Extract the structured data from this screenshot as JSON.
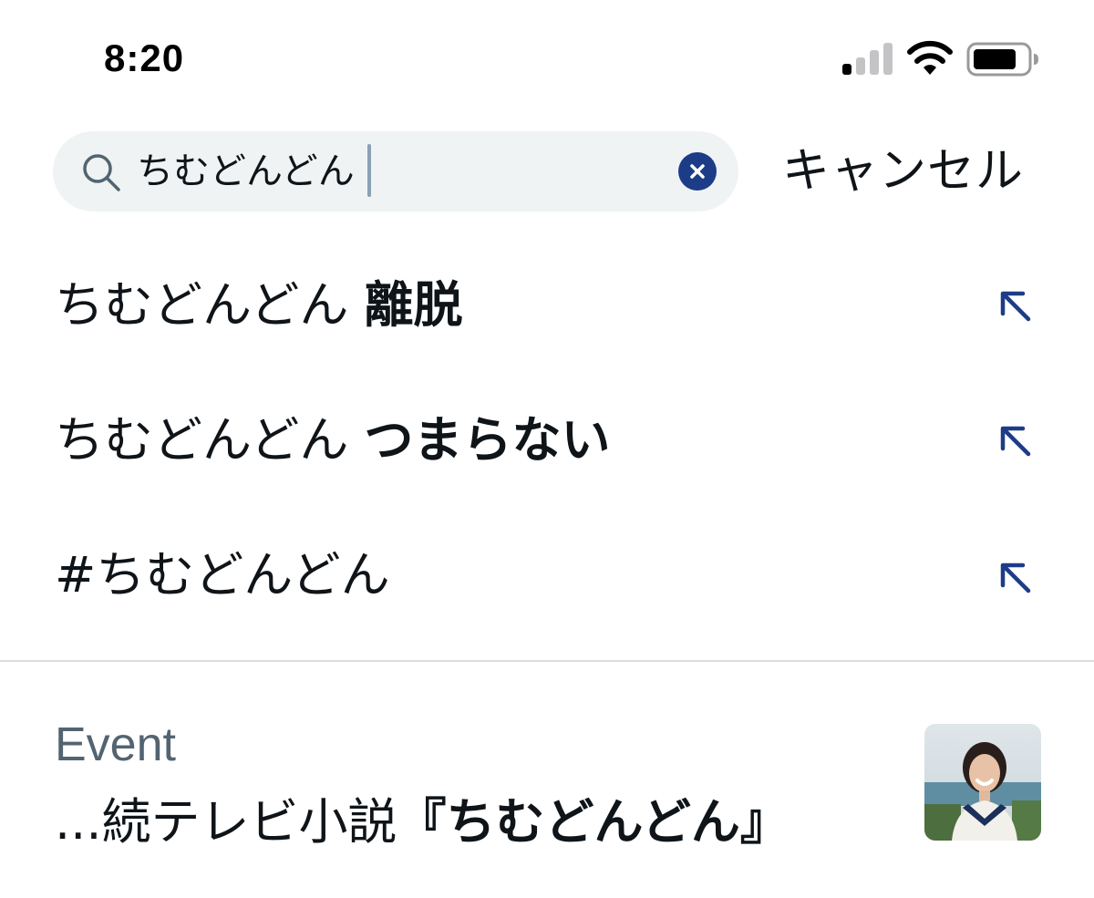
{
  "status_bar": {
    "time": "8:20",
    "signal_icon": "cellular-signal-icon",
    "wifi_icon": "wifi-icon",
    "battery_icon": "battery-icon"
  },
  "search": {
    "query": "ちむどんどん",
    "search_icon": "search-icon",
    "clear_icon": "clear-icon",
    "cancel_label": "キャンセル"
  },
  "suggestions": [
    {
      "prefix": "ちむどんどん ",
      "bold": "離脱",
      "icon": "arrow-up-left-icon"
    },
    {
      "prefix": "ちむどんどん ",
      "bold": "つまらない",
      "icon": "arrow-up-left-icon"
    },
    {
      "prefix": "#ちむどんどん",
      "bold": "",
      "icon": "arrow-up-left-icon"
    }
  ],
  "event": {
    "label": "Event",
    "title_prefix": "...続テレビ小説",
    "title_bold": "『ちむどんどん』",
    "thumbnail": "event-thumbnail-image"
  },
  "colors": {
    "accent": "#1d3c88",
    "search_bg": "#eff3f4",
    "secondary_text": "#536471"
  }
}
